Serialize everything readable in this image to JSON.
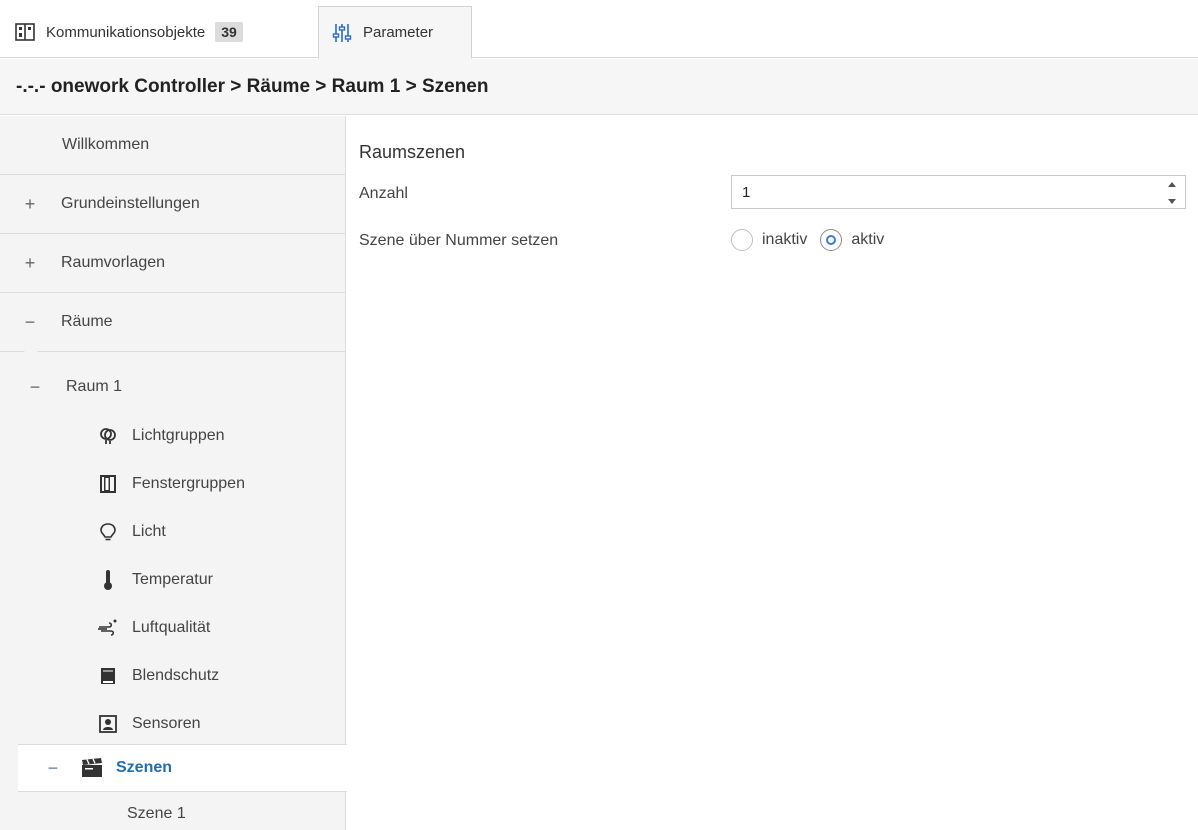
{
  "tabs": [
    {
      "label": "Kommunikationsobjekte",
      "badge": "39",
      "icon": "communication-objects-icon"
    },
    {
      "label": "Parameter",
      "icon": "parameter-sliders-icon",
      "active": true
    }
  ],
  "breadcrumb": "-.-.- onework Controller > Räume > Raum 1 > Szenen",
  "sidebar": {
    "welcome": "Willkommen",
    "top_items": [
      {
        "sign": "+",
        "label": "Grundeinstellungen"
      },
      {
        "sign": "+",
        "label": "Raumvorlagen"
      },
      {
        "sign": "−",
        "label": "Räume"
      }
    ],
    "raum": {
      "sign": "−",
      "label": "Raum 1"
    },
    "sub_items": [
      {
        "label": "Lichtgruppen",
        "icon": "light-group-icon"
      },
      {
        "label": "Fenstergruppen",
        "icon": "window-group-icon"
      },
      {
        "label": "Licht",
        "icon": "light-bulb-icon"
      },
      {
        "label": "Temperatur",
        "icon": "thermometer-icon"
      },
      {
        "label": "Luftqualität",
        "icon": "air-quality-icon"
      },
      {
        "label": "Blendschutz",
        "icon": "blind-icon"
      },
      {
        "label": "Sensoren",
        "icon": "sensor-icon"
      }
    ],
    "selected": {
      "sign": "−",
      "label": "Szenen",
      "icon": "scene-clapper-icon"
    },
    "child": {
      "label": "Szene 1"
    }
  },
  "main": {
    "section_title": "Raumszenen",
    "anzahl_label": "Anzahl",
    "anzahl_value": "1",
    "szene_label": "Szene über Nummer setzen",
    "radio_options": [
      "inaktiv",
      "aktiv"
    ],
    "radio_selected": "aktiv"
  },
  "colors": {
    "accent": "#1f6db5",
    "radio_checked": "#3c7bd1",
    "sidebar_bg": "#f4f4f4"
  }
}
